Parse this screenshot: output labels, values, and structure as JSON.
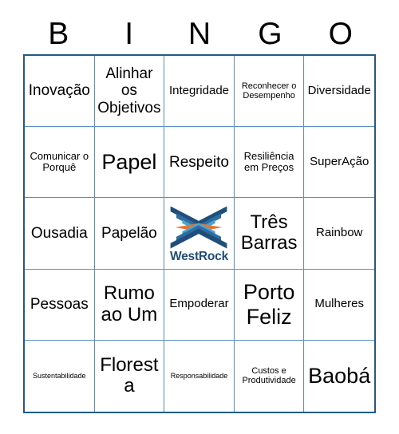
{
  "header": {
    "letters": [
      "B",
      "I",
      "N",
      "G",
      "O"
    ]
  },
  "colors": {
    "grid_outer_border": "#1F5C8B",
    "grid_inner_border": "#5B8FC7",
    "logo_navy": "#1F4E79",
    "logo_blue_dark": "#2E6DA4",
    "logo_blue_mid": "#2E8BC0",
    "logo_blue_light": "#4FA3D1",
    "logo_orange": "#E8762C",
    "text": "#000000",
    "background": "#FFFFFF"
  },
  "logo": {
    "name": "westrock-logo",
    "text": "WestRock"
  },
  "grid": {
    "rows": [
      [
        {
          "text": "Inovação",
          "size": "lg"
        },
        {
          "text": "Alinhar os Objetivos",
          "size": "lg"
        },
        {
          "text": "Integridade",
          "size": "md"
        },
        {
          "text": "Reconhecer o Desempenho",
          "size": "xs"
        },
        {
          "text": "Diversidade",
          "size": "md"
        }
      ],
      [
        {
          "text": "Comunicar o Porquê",
          "size": "sm"
        },
        {
          "text": "Papel",
          "size": "xxl"
        },
        {
          "text": "Respeito",
          "size": "lg"
        },
        {
          "text": "Resiliência em Preços",
          "size": "sm"
        },
        {
          "text": "SuperAção",
          "size": "md"
        }
      ],
      [
        {
          "text": "Ousadia",
          "size": "lg"
        },
        {
          "text": "Papelão",
          "size": "lg"
        },
        {
          "text": "",
          "size": "md",
          "free": true
        },
        {
          "text": "Três Barras",
          "size": "xl"
        },
        {
          "text": "Rainbow",
          "size": "md"
        }
      ],
      [
        {
          "text": "Pessoas",
          "size": "lg"
        },
        {
          "text": "Rumo ao Um",
          "size": "xl"
        },
        {
          "text": "Empoderar",
          "size": "md"
        },
        {
          "text": "Porto Feliz",
          "size": "xxl"
        },
        {
          "text": "Mulheres",
          "size": "md"
        }
      ],
      [
        {
          "text": "Sustentabilidade",
          "size": "xxs"
        },
        {
          "text": "Floresta",
          "size": "xl"
        },
        {
          "text": "Responsabilidade",
          "size": "xxs"
        },
        {
          "text": "Custos e Produtividade",
          "size": "xs"
        },
        {
          "text": "Baobá",
          "size": "xxl"
        }
      ]
    ]
  }
}
